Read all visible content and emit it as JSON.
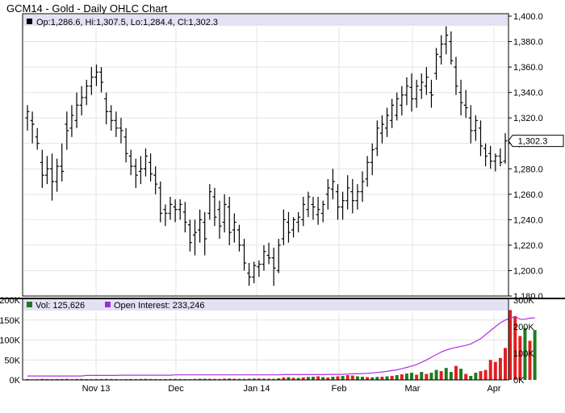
{
  "header": {
    "title": "GCM14 - Gold - Daily OHLC Chart"
  },
  "legend": {
    "ohlc": "Op:1,286.6, Hi:1,307.5, Lo:1,284.4, Cl:1,302.3",
    "volume": "Vol: 125,626",
    "open_interest": "Open Interest: 233,246"
  },
  "last_price_tag": "1,302.3",
  "colors": {
    "background": "#ffffff",
    "grid": "#e4e4e4",
    "legend_band": "#e2e2f4",
    "ohlc_bar": "#000000",
    "volume_up": "#1f7a1f",
    "volume_down": "#e02020",
    "open_interest_line": "#b030e0",
    "vol_marker": "#1f7a1f",
    "oi_marker": "#9b30d0"
  },
  "chart_data": [
    {
      "type": "ohlc",
      "x_ticks": [
        "Nov 13",
        "Dec",
        "Jan 14",
        "Feb",
        "Mar",
        "Apr"
      ],
      "x_tick_positions": [
        0,
        0,
        0,
        0,
        0,
        0
      ],
      "y_ticks": [
        "1,180.0",
        "1,200.0",
        "1,220.0",
        "1,240.0",
        "1,260.0",
        "1,280.0",
        "1,300.0",
        "1,320.0",
        "1,340.0",
        "1,360.0",
        "1,380.0",
        "1,400.0"
      ],
      "ylim": [
        1180,
        1400
      ],
      "grid": true,
      "ohlc": [
        [
          1320,
          1330,
          1310,
          1325
        ],
        [
          1318,
          1325,
          1300,
          1315
        ],
        [
          1305,
          1312,
          1295,
          1300
        ],
        [
          1285,
          1295,
          1265,
          1275
        ],
        [
          1275,
          1290,
          1268,
          1280
        ],
        [
          1280,
          1292,
          1255,
          1270
        ],
        [
          1270,
          1288,
          1262,
          1282
        ],
        [
          1282,
          1300,
          1270,
          1278
        ],
        [
          1315,
          1325,
          1295,
          1310
        ],
        [
          1312,
          1330,
          1305,
          1322
        ],
        [
          1318,
          1340,
          1312,
          1330
        ],
        [
          1330,
          1345,
          1322,
          1336
        ],
        [
          1336,
          1350,
          1330,
          1345
        ],
        [
          1345,
          1360,
          1338,
          1352
        ],
        [
          1352,
          1362,
          1345,
          1356
        ],
        [
          1356,
          1360,
          1340,
          1348
        ],
        [
          1335,
          1340,
          1315,
          1325
        ],
        [
          1325,
          1330,
          1310,
          1318
        ],
        [
          1318,
          1325,
          1305,
          1312
        ],
        [
          1312,
          1320,
          1300,
          1310
        ],
        [
          1305,
          1312,
          1285,
          1292
        ],
        [
          1290,
          1295,
          1275,
          1282
        ],
        [
          1282,
          1288,
          1265,
          1275
        ],
        [
          1278,
          1290,
          1268,
          1280
        ],
        [
          1280,
          1296,
          1274,
          1290
        ],
        [
          1285,
          1292,
          1270,
          1276
        ],
        [
          1275,
          1282,
          1260,
          1268
        ],
        [
          1265,
          1270,
          1238,
          1245
        ],
        [
          1248,
          1252,
          1235,
          1245
        ],
        [
          1245,
          1258,
          1240,
          1252
        ],
        [
          1250,
          1256,
          1238,
          1248
        ],
        [
          1248,
          1256,
          1240,
          1252
        ],
        [
          1246,
          1254,
          1230,
          1238
        ],
        [
          1236,
          1240,
          1215,
          1222
        ],
        [
          1228,
          1240,
          1212,
          1230
        ],
        [
          1232,
          1248,
          1222,
          1240
        ],
        [
          1238,
          1246,
          1212,
          1225
        ],
        [
          1245,
          1268,
          1240,
          1262
        ],
        [
          1258,
          1265,
          1235,
          1242
        ],
        [
          1248,
          1255,
          1225,
          1235
        ],
        [
          1238,
          1260,
          1230,
          1252
        ],
        [
          1250,
          1258,
          1220,
          1230
        ],
        [
          1232,
          1245,
          1222,
          1238
        ],
        [
          1232,
          1236,
          1215,
          1220
        ],
        [
          1220,
          1225,
          1200,
          1206
        ],
        [
          1198,
          1206,
          1188,
          1195
        ],
        [
          1195,
          1207,
          1190,
          1204
        ],
        [
          1203,
          1208,
          1195,
          1205
        ],
        [
          1205,
          1220,
          1200,
          1215
        ],
        [
          1212,
          1222,
          1205,
          1210
        ],
        [
          1210,
          1218,
          1188,
          1202
        ],
        [
          1200,
          1225,
          1198,
          1220
        ],
        [
          1225,
          1248,
          1220,
          1240
        ],
        [
          1238,
          1246,
          1222,
          1230
        ],
        [
          1232,
          1242,
          1226,
          1240
        ],
        [
          1238,
          1246,
          1230,
          1242
        ],
        [
          1240,
          1258,
          1235,
          1252
        ],
        [
          1248,
          1262,
          1242,
          1258
        ],
        [
          1252,
          1258,
          1240,
          1250
        ],
        [
          1244,
          1258,
          1236,
          1248
        ],
        [
          1245,
          1255,
          1238,
          1252
        ],
        [
          1260,
          1272,
          1248,
          1265
        ],
        [
          1264,
          1280,
          1256,
          1270
        ],
        [
          1262,
          1268,
          1240,
          1250
        ],
        [
          1250,
          1262,
          1240,
          1255
        ],
        [
          1255,
          1275,
          1248,
          1265
        ],
        [
          1262,
          1272,
          1245,
          1255
        ],
        [
          1255,
          1268,
          1248,
          1262
        ],
        [
          1262,
          1278,
          1254,
          1270
        ],
        [
          1272,
          1290,
          1266,
          1285
        ],
        [
          1285,
          1300,
          1275,
          1295
        ],
        [
          1296,
          1318,
          1290,
          1312
        ],
        [
          1308,
          1322,
          1300,
          1315
        ],
        [
          1312,
          1328,
          1305,
          1322
        ],
        [
          1318,
          1335,
          1312,
          1330
        ],
        [
          1322,
          1340,
          1318,
          1335
        ],
        [
          1330,
          1345,
          1322,
          1338
        ],
        [
          1338,
          1352,
          1330,
          1345
        ],
        [
          1344,
          1355,
          1325,
          1335
        ],
        [
          1335,
          1350,
          1328,
          1345
        ],
        [
          1342,
          1355,
          1335,
          1348
        ],
        [
          1345,
          1360,
          1338,
          1352
        ],
        [
          1340,
          1350,
          1328,
          1338
        ],
        [
          1355,
          1375,
          1350,
          1370
        ],
        [
          1368,
          1385,
          1362,
          1378
        ],
        [
          1378,
          1392,
          1370,
          1385
        ],
        [
          1380,
          1388,
          1362,
          1365
        ],
        [
          1360,
          1368,
          1338,
          1345
        ],
        [
          1340,
          1350,
          1322,
          1332
        ],
        [
          1330,
          1342,
          1320,
          1328
        ],
        [
          1320,
          1330,
          1300,
          1310
        ],
        [
          1310,
          1322,
          1302,
          1318
        ],
        [
          1312,
          1318,
          1290,
          1298
        ],
        [
          1296,
          1300,
          1282,
          1290
        ],
        [
          1292,
          1298,
          1280,
          1286
        ],
        [
          1286,
          1292,
          1278,
          1290
        ],
        [
          1290,
          1296,
          1282,
          1285
        ],
        [
          1286,
          1308,
          1284,
          1302
        ]
      ]
    },
    {
      "type": "bar",
      "y_ticks": [
        "0K",
        "50K",
        "100K",
        "150K",
        "200K"
      ],
      "ylim": [
        0,
        200000
      ],
      "y2_ticks": [
        "0K",
        "100K",
        "200K",
        "300K"
      ],
      "y2lim": [
        0,
        300000
      ],
      "series": [
        {
          "name": "Vol",
          "values": [
            2000,
            1500,
            1800,
            2500,
            2200,
            1900,
            2100,
            2300,
            2600,
            1800,
            2200,
            2400,
            2000,
            1900,
            2100,
            2200,
            2500,
            2300,
            2000,
            1700,
            1900,
            2100,
            2000,
            2400,
            2600,
            2300,
            2100,
            1900,
            2000,
            2200,
            2500,
            2300,
            2000,
            1800,
            2600,
            2900,
            3000,
            2800,
            2500,
            2400,
            3200,
            3500,
            3000,
            2800,
            2600,
            3100,
            3400,
            3600,
            3200,
            3000,
            2700,
            4000,
            6000,
            7000,
            5500,
            5000,
            6500,
            7500,
            8000,
            9000,
            7000,
            6000,
            8000,
            9000,
            10000,
            12000,
            11000,
            9000,
            8000,
            7000,
            6500,
            7500,
            8000,
            9000,
            10000,
            12000,
            14000,
            16000,
            18000,
            13000,
            20000,
            15000,
            18000,
            25000,
            22000,
            30000,
            20000,
            35000,
            28000,
            15000,
            10000,
            18000,
            22000,
            25000,
            50000,
            45000,
            55000,
            80000,
            175000,
            160000,
            110000,
            130000,
            98000,
            125000
          ],
          "up": [
            true,
            false,
            true,
            false,
            true,
            false,
            true,
            true,
            false,
            true,
            false,
            true,
            true,
            false,
            true,
            false,
            false,
            true,
            true,
            false,
            false,
            true,
            false,
            true,
            true,
            false,
            true,
            false,
            false,
            true,
            true,
            false,
            true,
            false,
            false,
            true,
            true,
            false,
            true,
            false,
            false,
            true,
            false,
            true,
            true,
            false,
            true,
            false,
            true,
            false,
            true,
            true,
            false,
            true,
            false,
            true,
            false,
            true,
            true,
            false,
            true,
            false,
            true,
            false,
            true,
            false,
            false,
            true,
            true,
            false,
            true,
            true,
            false,
            true,
            false,
            true,
            false,
            true,
            true,
            false,
            true,
            false,
            true,
            true,
            false,
            true,
            true,
            false,
            true,
            false,
            true,
            true,
            false,
            false,
            false,
            false,
            false,
            false,
            false,
            false,
            false,
            true,
            false,
            true
          ]
        },
        {
          "name": "Open Interest",
          "values": [
            15000,
            15000,
            15000,
            15000,
            15000,
            15000,
            15000,
            15000,
            15000,
            15000,
            15000,
            15000,
            17000,
            17000,
            17000,
            17000,
            17000,
            17000,
            17000,
            18000,
            18000,
            18000,
            18000,
            18000,
            18000,
            18000,
            18000,
            18000,
            18000,
            18000,
            19000,
            19000,
            19000,
            19000,
            19000,
            19000,
            19000,
            19000,
            19000,
            19000,
            19000,
            19000,
            19000,
            19000,
            19000,
            19000,
            19000,
            19000,
            19000,
            19000,
            19000,
            19000,
            20000,
            20000,
            20000,
            20000,
            20000,
            20000,
            20000,
            20000,
            20000,
            21000,
            21000,
            21000,
            21000,
            22000,
            23000,
            23000,
            24000,
            25000,
            26000,
            28000,
            30000,
            32000,
            35000,
            38000,
            42000,
            47000,
            52000,
            58000,
            66000,
            75000,
            85000,
            95000,
            105000,
            112000,
            118000,
            122000,
            126000,
            130000,
            135000,
            145000,
            155000,
            170000,
            185000,
            200000,
            215000,
            225000,
            232000,
            238000,
            228000,
            228000,
            232000,
            233246
          ]
        }
      ]
    }
  ]
}
